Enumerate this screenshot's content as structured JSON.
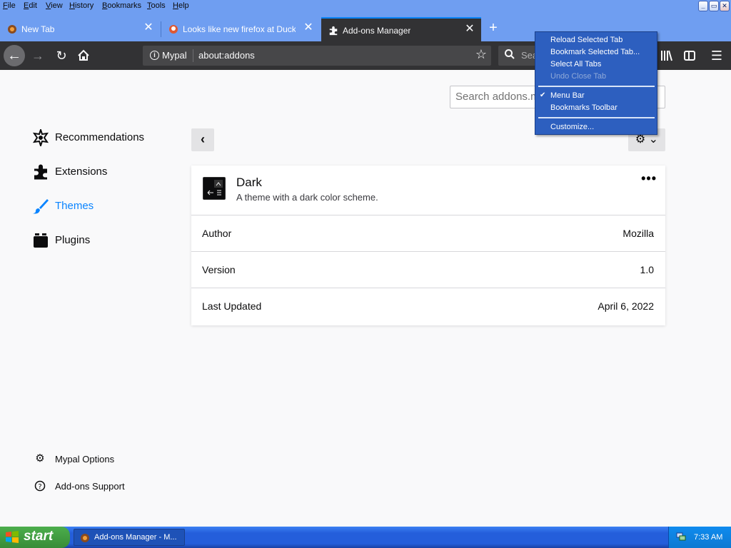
{
  "menubar": {
    "items": [
      "File",
      "Edit",
      "View",
      "History",
      "Bookmarks",
      "Tools",
      "Help"
    ],
    "window_buttons": [
      "_",
      "▭",
      "✕"
    ]
  },
  "tabs": [
    {
      "title": "New Tab",
      "icon": "firefox-icon"
    },
    {
      "title": "Looks like new firefox at DuckDuck",
      "icon": "duckduckgo-icon"
    },
    {
      "title": "Add-ons Manager",
      "icon": "puzzle-icon",
      "active": true
    }
  ],
  "navbar": {
    "identity": "Mypal",
    "url": "about:addons",
    "search_placeholder": "Sea"
  },
  "content": {
    "search_placeholder": "Search addons.mo",
    "categories": [
      "Recommendations",
      "Extensions",
      "Themes",
      "Plugins"
    ],
    "selected_category": "Themes",
    "footer": {
      "options": "Mypal Options",
      "support": "Add-ons Support"
    },
    "addon": {
      "name": "Dark",
      "description": "A theme with a dark color scheme.",
      "details": [
        {
          "label": "Author",
          "value": "Mozilla"
        },
        {
          "label": "Version",
          "value": "1.0"
        },
        {
          "label": "Last Updated",
          "value": "April 6, 2022"
        }
      ]
    }
  },
  "context_menu": {
    "items": [
      "Reload Selected Tab",
      "Bookmark Selected Tab...",
      "Select All Tabs",
      "Undo Close Tab",
      "Menu Bar",
      "Bookmarks Toolbar",
      "Customize..."
    ],
    "disabled": [
      "Undo Close Tab"
    ],
    "checked": [
      "Menu Bar"
    ]
  },
  "taskbar": {
    "start_label": "start",
    "task_label": "Add-ons Manager - M...",
    "clock": "7:33 AM"
  },
  "colors": {
    "accent": "#0a84ff",
    "toolbar_dark": "#323234",
    "xp_blue": "#245edb",
    "menu_blue": "#2d5fbf"
  }
}
